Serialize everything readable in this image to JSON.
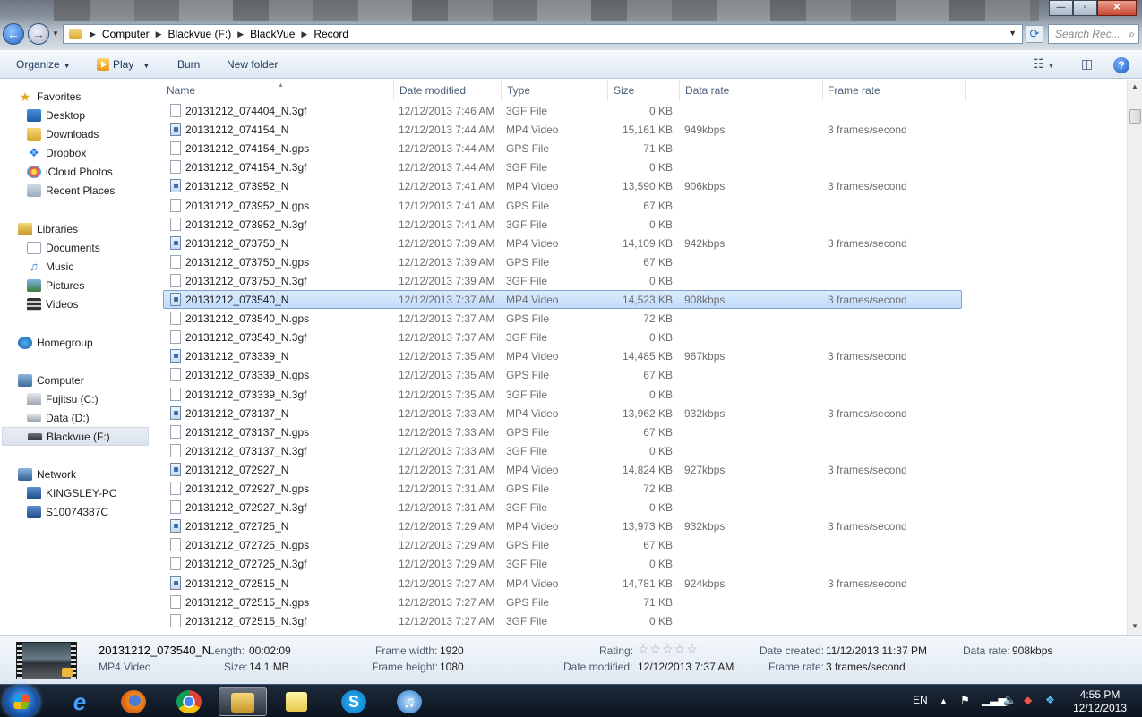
{
  "address": {
    "crumbs": [
      "Computer",
      "Blackvue (F:)",
      "BlackVue",
      "Record"
    ],
    "search_placeholder": "Search Rec..."
  },
  "window_controls": {
    "minimize": "—",
    "maximize": "▫",
    "close": "✕"
  },
  "toolbar": {
    "organize": "Organize",
    "play": "Play",
    "burn": "Burn",
    "new_folder": "New folder"
  },
  "nav": {
    "favorites": "Favorites",
    "desktop": "Desktop",
    "downloads": "Downloads",
    "dropbox": "Dropbox",
    "icloud": "iCloud Photos",
    "recent": "Recent Places",
    "libraries": "Libraries",
    "documents": "Documents",
    "music": "Music",
    "pictures": "Pictures",
    "videos": "Videos",
    "homegroup": "Homegroup",
    "computer": "Computer",
    "fujitsu": "Fujitsu (C:)",
    "data": "Data (D:)",
    "blackvue": "Blackvue (F:)",
    "network": "Network",
    "pc1": "KINGSLEY-PC",
    "pc2": "S10074387C"
  },
  "columns": {
    "name": "Name",
    "date": "Date modified",
    "type": "Type",
    "size": "Size",
    "rate": "Data rate",
    "fps": "Frame rate"
  },
  "files": [
    {
      "name": "20131212_074404_N.3gf",
      "date": "12/12/2013 7:46 AM",
      "type": "3GF File",
      "size": "0 KB",
      "rate": "",
      "fps": "",
      "video": false
    },
    {
      "name": "20131212_074154_N",
      "date": "12/12/2013 7:44 AM",
      "type": "MP4 Video",
      "size": "15,161 KB",
      "rate": "949kbps",
      "fps": "3 frames/second",
      "video": true
    },
    {
      "name": "20131212_074154_N.gps",
      "date": "12/12/2013 7:44 AM",
      "type": "GPS File",
      "size": "71 KB",
      "rate": "",
      "fps": "",
      "video": false
    },
    {
      "name": "20131212_074154_N.3gf",
      "date": "12/12/2013 7:44 AM",
      "type": "3GF File",
      "size": "0 KB",
      "rate": "",
      "fps": "",
      "video": false
    },
    {
      "name": "20131212_073952_N",
      "date": "12/12/2013 7:41 AM",
      "type": "MP4 Video",
      "size": "13,590 KB",
      "rate": "906kbps",
      "fps": "3 frames/second",
      "video": true
    },
    {
      "name": "20131212_073952_N.gps",
      "date": "12/12/2013 7:41 AM",
      "type": "GPS File",
      "size": "67 KB",
      "rate": "",
      "fps": "",
      "video": false
    },
    {
      "name": "20131212_073952_N.3gf",
      "date": "12/12/2013 7:41 AM",
      "type": "3GF File",
      "size": "0 KB",
      "rate": "",
      "fps": "",
      "video": false
    },
    {
      "name": "20131212_073750_N",
      "date": "12/12/2013 7:39 AM",
      "type": "MP4 Video",
      "size": "14,109 KB",
      "rate": "942kbps",
      "fps": "3 frames/second",
      "video": true
    },
    {
      "name": "20131212_073750_N.gps",
      "date": "12/12/2013 7:39 AM",
      "type": "GPS File",
      "size": "67 KB",
      "rate": "",
      "fps": "",
      "video": false
    },
    {
      "name": "20131212_073750_N.3gf",
      "date": "12/12/2013 7:39 AM",
      "type": "3GF File",
      "size": "0 KB",
      "rate": "",
      "fps": "",
      "video": false
    },
    {
      "name": "20131212_073540_N",
      "date": "12/12/2013 7:37 AM",
      "type": "MP4 Video",
      "size": "14,523 KB",
      "rate": "908kbps",
      "fps": "3 frames/second",
      "video": true,
      "selected": true
    },
    {
      "name": "20131212_073540_N.gps",
      "date": "12/12/2013 7:37 AM",
      "type": "GPS File",
      "size": "72 KB",
      "rate": "",
      "fps": "",
      "video": false
    },
    {
      "name": "20131212_073540_N.3gf",
      "date": "12/12/2013 7:37 AM",
      "type": "3GF File",
      "size": "0 KB",
      "rate": "",
      "fps": "",
      "video": false
    },
    {
      "name": "20131212_073339_N",
      "date": "12/12/2013 7:35 AM",
      "type": "MP4 Video",
      "size": "14,485 KB",
      "rate": "967kbps",
      "fps": "3 frames/second",
      "video": true
    },
    {
      "name": "20131212_073339_N.gps",
      "date": "12/12/2013 7:35 AM",
      "type": "GPS File",
      "size": "67 KB",
      "rate": "",
      "fps": "",
      "video": false
    },
    {
      "name": "20131212_073339_N.3gf",
      "date": "12/12/2013 7:35 AM",
      "type": "3GF File",
      "size": "0 KB",
      "rate": "",
      "fps": "",
      "video": false
    },
    {
      "name": "20131212_073137_N",
      "date": "12/12/2013 7:33 AM",
      "type": "MP4 Video",
      "size": "13,962 KB",
      "rate": "932kbps",
      "fps": "3 frames/second",
      "video": true
    },
    {
      "name": "20131212_073137_N.gps",
      "date": "12/12/2013 7:33 AM",
      "type": "GPS File",
      "size": "67 KB",
      "rate": "",
      "fps": "",
      "video": false
    },
    {
      "name": "20131212_073137_N.3gf",
      "date": "12/12/2013 7:33 AM",
      "type": "3GF File",
      "size": "0 KB",
      "rate": "",
      "fps": "",
      "video": false
    },
    {
      "name": "20131212_072927_N",
      "date": "12/12/2013 7:31 AM",
      "type": "MP4 Video",
      "size": "14,824 KB",
      "rate": "927kbps",
      "fps": "3 frames/second",
      "video": true
    },
    {
      "name": "20131212_072927_N.gps",
      "date": "12/12/2013 7:31 AM",
      "type": "GPS File",
      "size": "72 KB",
      "rate": "",
      "fps": "",
      "video": false
    },
    {
      "name": "20131212_072927_N.3gf",
      "date": "12/12/2013 7:31 AM",
      "type": "3GF File",
      "size": "0 KB",
      "rate": "",
      "fps": "",
      "video": false
    },
    {
      "name": "20131212_072725_N",
      "date": "12/12/2013 7:29 AM",
      "type": "MP4 Video",
      "size": "13,973 KB",
      "rate": "932kbps",
      "fps": "3 frames/second",
      "video": true
    },
    {
      "name": "20131212_072725_N.gps",
      "date": "12/12/2013 7:29 AM",
      "type": "GPS File",
      "size": "67 KB",
      "rate": "",
      "fps": "",
      "video": false
    },
    {
      "name": "20131212_072725_N.3gf",
      "date": "12/12/2013 7:29 AM",
      "type": "3GF File",
      "size": "0 KB",
      "rate": "",
      "fps": "",
      "video": false
    },
    {
      "name": "20131212_072515_N",
      "date": "12/12/2013 7:27 AM",
      "type": "MP4 Video",
      "size": "14,781 KB",
      "rate": "924kbps",
      "fps": "3 frames/second",
      "video": true
    },
    {
      "name": "20131212_072515_N.gps",
      "date": "12/12/2013 7:27 AM",
      "type": "GPS File",
      "size": "71 KB",
      "rate": "",
      "fps": "",
      "video": false
    },
    {
      "name": "20131212_072515_N.3gf",
      "date": "12/12/2013 7:27 AM",
      "type": "3GF File",
      "size": "0 KB",
      "rate": "",
      "fps": "",
      "video": false
    }
  ],
  "details": {
    "filename": "20131212_073540_N",
    "filetype": "MP4 Video",
    "length_label": "Length:",
    "length": "00:02:09",
    "size_label": "Size:",
    "size": "14.1 MB",
    "fw_label": "Frame width:",
    "fw": "1920",
    "fh_label": "Frame height:",
    "fh": "1080",
    "rating_label": "Rating:",
    "rating_stars": "☆☆☆☆☆",
    "dm_label": "Date modified:",
    "dm": "12/12/2013 7:37 AM",
    "dc_label": "Date created:",
    "dc": "11/12/2013 11:37 PM",
    "fr_label": "Frame rate:",
    "fr": "3 frames/second",
    "dr_label": "Data rate:",
    "dr": "908kbps"
  },
  "taskbar": {
    "lang": "EN",
    "time": "4:55 PM",
    "date": "12/12/2013"
  }
}
